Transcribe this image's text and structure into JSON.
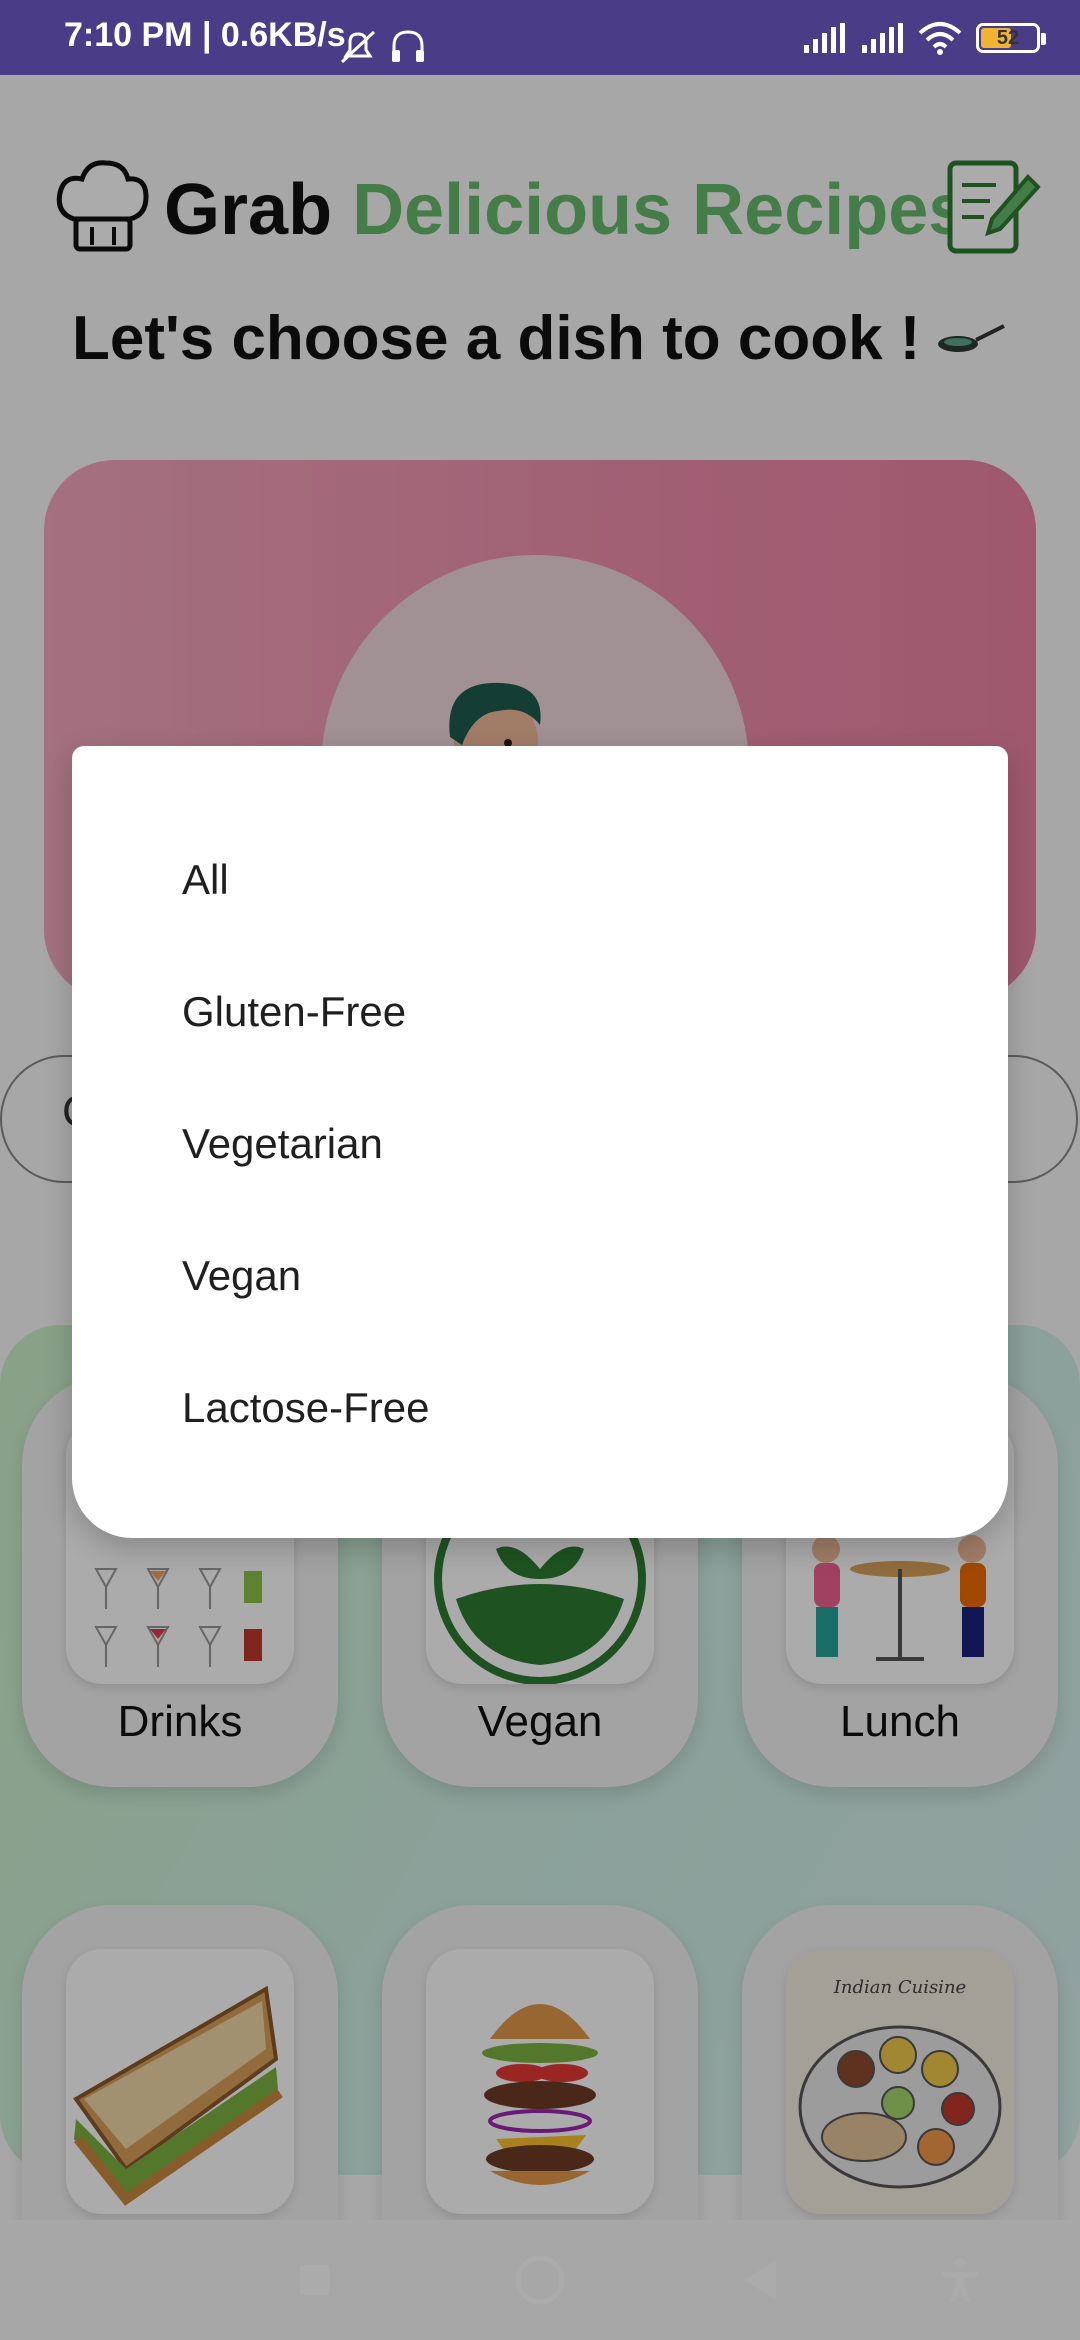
{
  "status_bar": {
    "time_and_speed": "7:10 PM | 0.6KB/s",
    "battery": "52",
    "battery_level_percent": 52
  },
  "header": {
    "title_part1": "Grab",
    "title_part2": "Delicious Recipes",
    "subtitle": "Let's choose a dish to cook !"
  },
  "search": {
    "partial_text": "C"
  },
  "categories": [
    {
      "label": "Drinks",
      "icon": "cocktails-icon"
    },
    {
      "label": "Vegan",
      "icon": "vegan-leaf-icon"
    },
    {
      "label": "Lunch",
      "icon": "couple-dining-icon"
    },
    {
      "label": "",
      "icon": "sandwich-icon"
    },
    {
      "label": "",
      "icon": "burger-icon"
    },
    {
      "label": "",
      "icon": "indian-thali-icon"
    }
  ],
  "thali_card_text": "Indian Cuisine",
  "dropdown": {
    "options": [
      "All",
      "Gluten-Free",
      "Vegetarian",
      "Vegan",
      "Lactose-Free"
    ]
  },
  "colors": {
    "status_bar": "#4a3c86",
    "title_accent": "#66bb6a",
    "hero_pink": "#f08fae"
  }
}
